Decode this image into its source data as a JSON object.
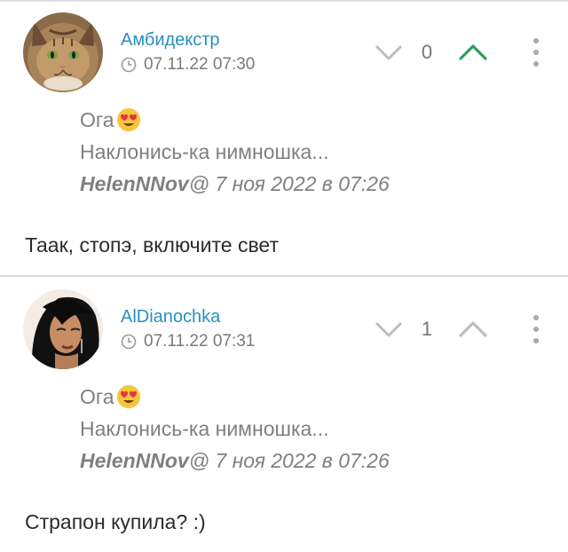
{
  "comments": [
    {
      "author": "Амбидекстр",
      "datetime": "07.11.22 07:30",
      "score": "0",
      "quote": {
        "line1": "Ога",
        "line2": "Наклонись-ка нимношка...",
        "user": "HelenNNov",
        "cite_rest": " @ 7 ноя 2022 в 07:26"
      },
      "text": "Таак, стопэ, включите свет",
      "upvote_color": "#2aa05f"
    },
    {
      "author": "AlDianochka",
      "datetime": "07.11.22 07:31",
      "score": "1",
      "quote": {
        "line1": "Ога",
        "line2": "Наклонись-ка нимношка...",
        "user": "HelenNNov",
        "cite_rest": " @ 7 ноя 2022 в 07:26"
      },
      "text": "Страпон купила? :)",
      "upvote_color": "#bdbdbd"
    }
  ],
  "icons": {
    "clock": "clock-icon",
    "vote_down": "chevron-down-icon",
    "vote_up": "chevron-up-icon",
    "more": "more-vertical-icon",
    "emoji": "heart-eyes-emoji"
  },
  "colors": {
    "author": "#2a8fbd",
    "divider": "#dcdcdc",
    "quote": "#7f7f7f"
  }
}
